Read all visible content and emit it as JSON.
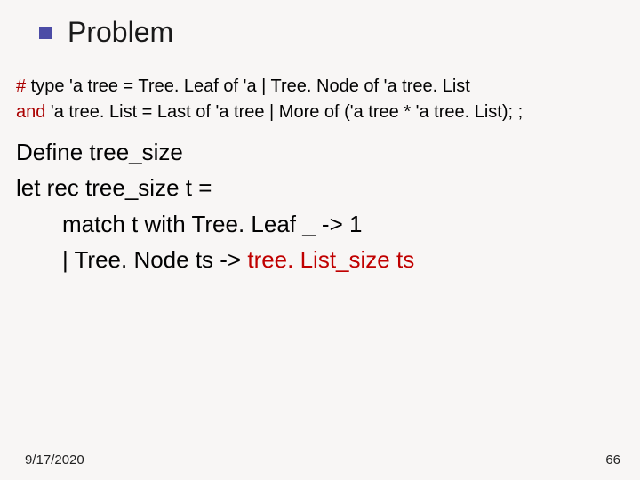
{
  "header": {
    "title": "Problem"
  },
  "typedef": {
    "hash": "#",
    "line1_rest": " type 'a tree = Tree. Leaf of 'a | Tree. Node of 'a tree. List",
    "andkw": "and",
    "line2_rest": " 'a tree. List = Last of 'a tree | More of ('a tree * 'a tree. List); ;"
  },
  "body": {
    "line1": "Define tree_size",
    "line2": "let rec tree_size t =",
    "line3": "match t with Tree. Leaf _ -> 1",
    "line4_pre": "| Tree. Node ts -> ",
    "line4_hl": "tree. List_size  ts"
  },
  "footer": {
    "date": "9/17/2020",
    "page": "66"
  }
}
